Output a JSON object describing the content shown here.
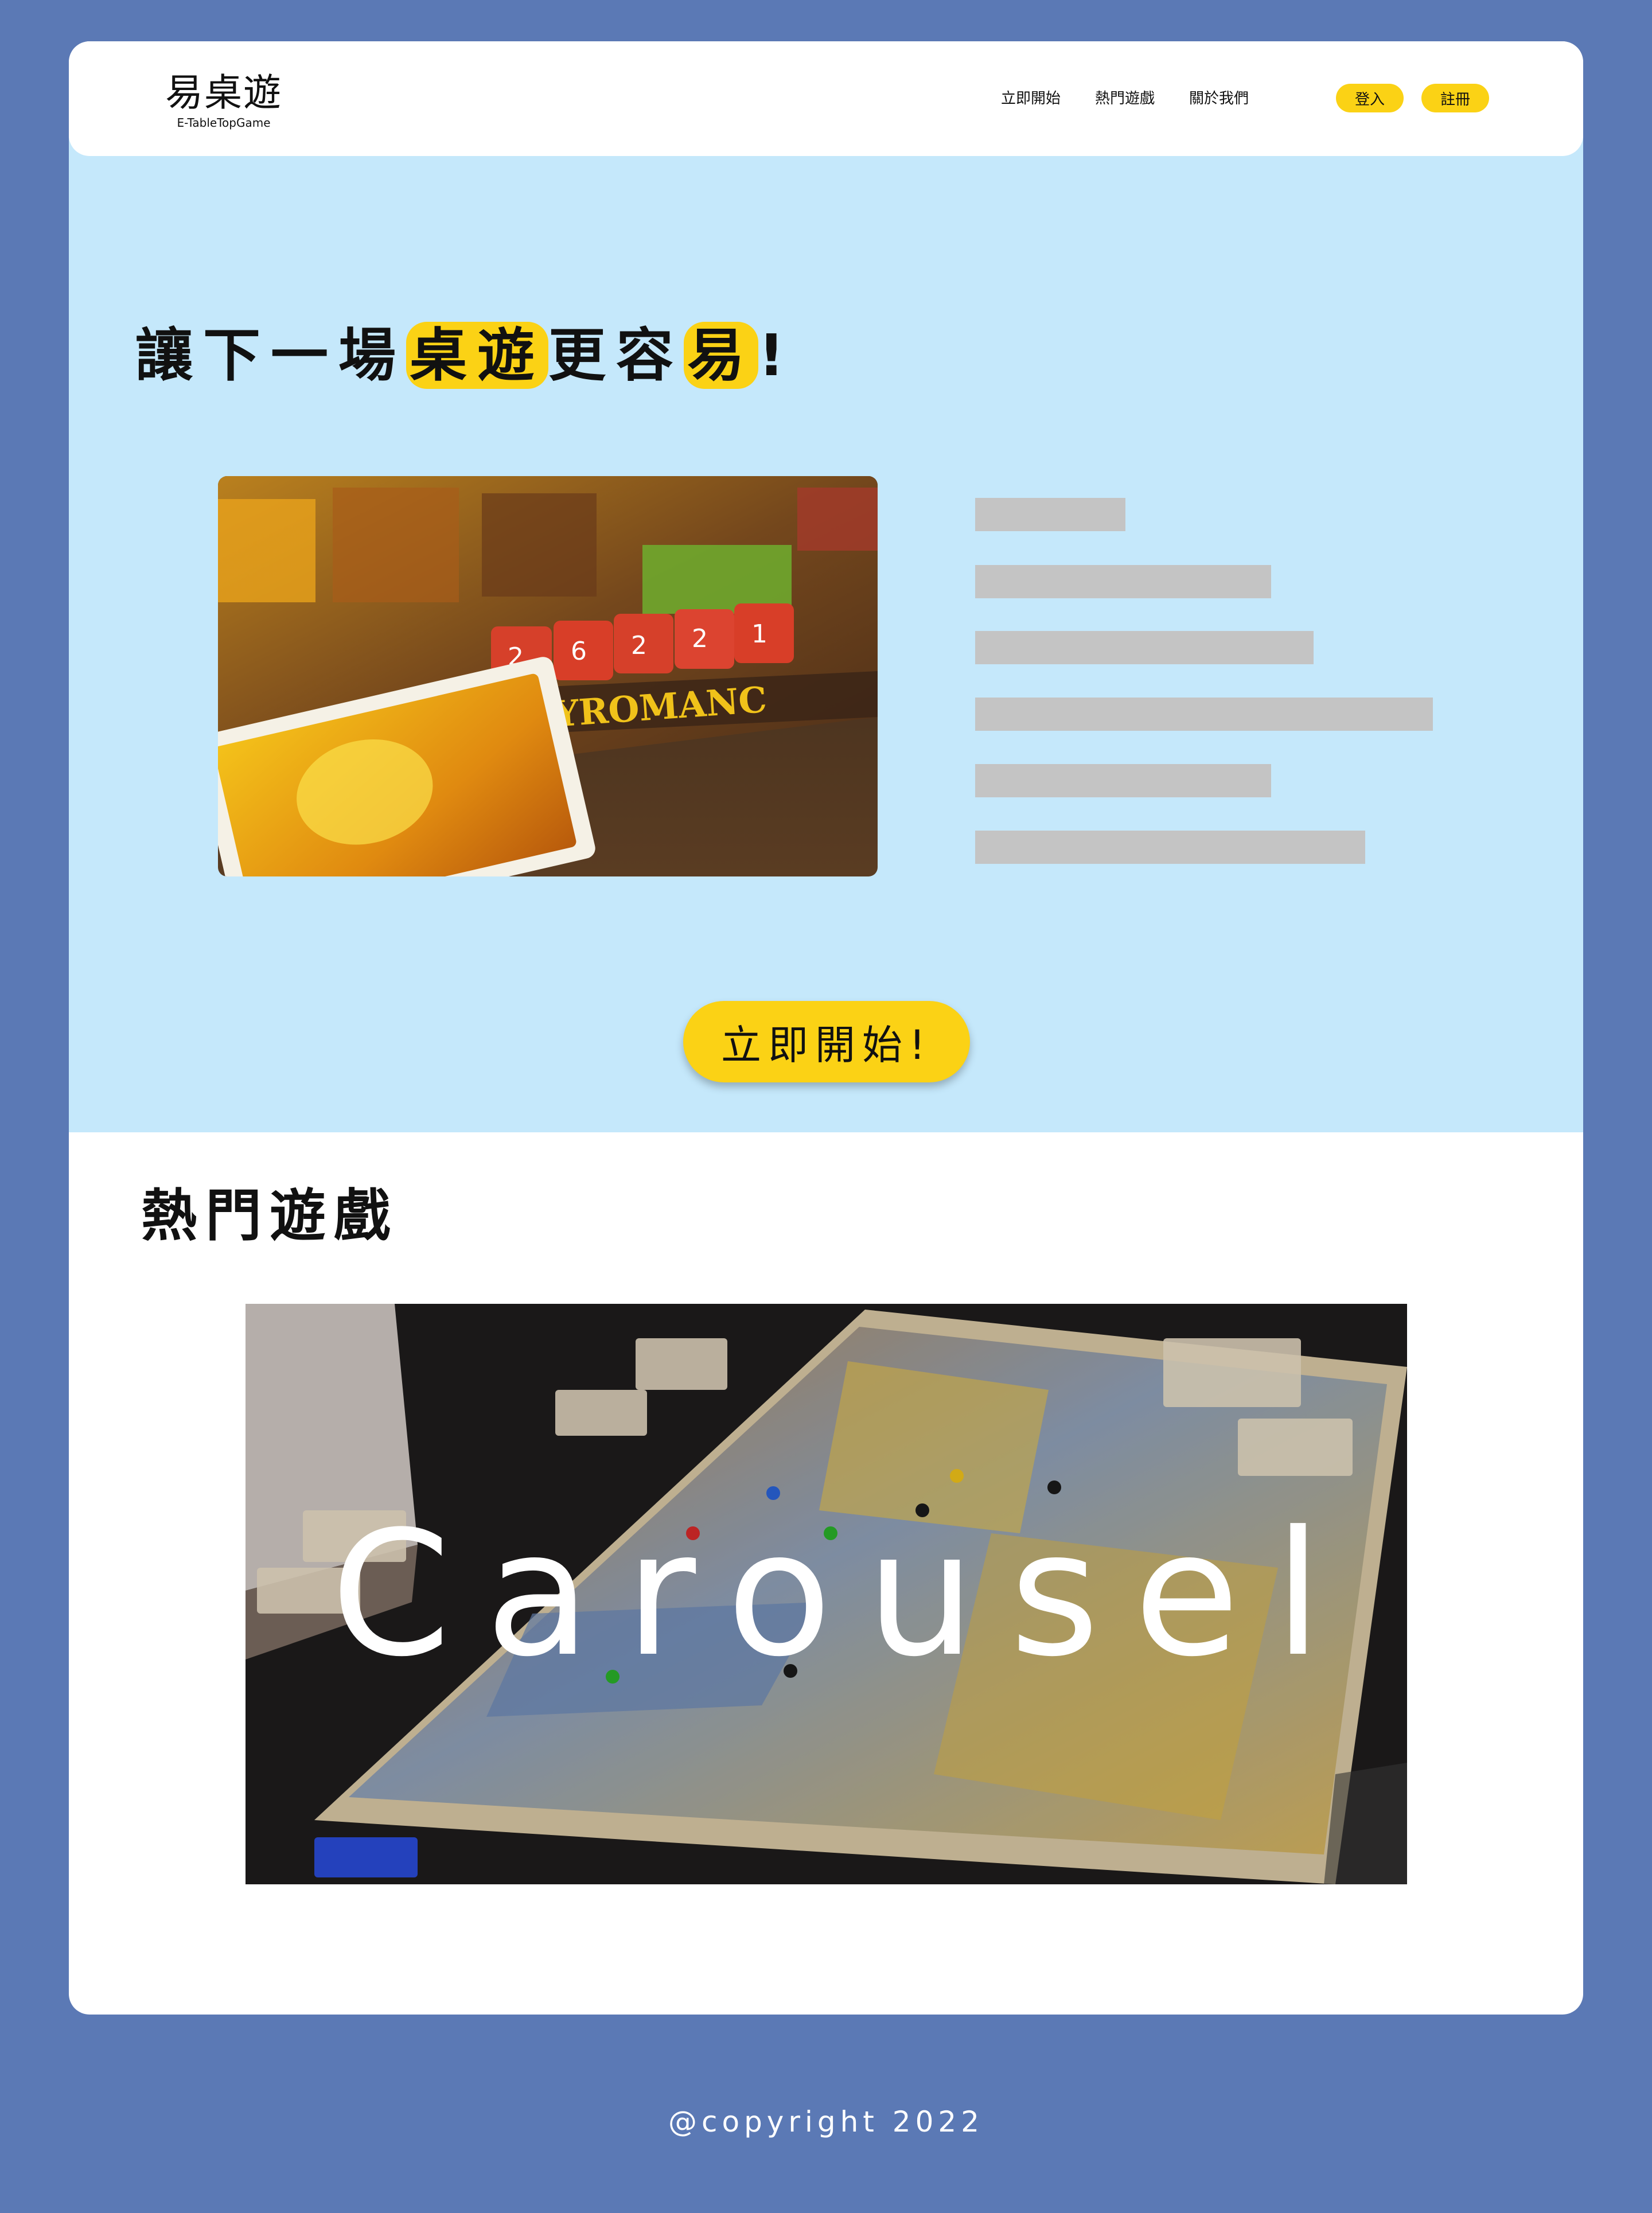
{
  "logo": {
    "main": "易桌遊",
    "sub": "E-TableTopGame"
  },
  "nav": {
    "items": [
      "立即開始",
      "熱門遊戲",
      "關於我們"
    ]
  },
  "auth": {
    "login": "登入",
    "signup": "註冊"
  },
  "hero": {
    "title_parts": [
      "讓下一場",
      "桌遊",
      "更容",
      "易",
      "!"
    ],
    "image_name": "pyromancer-board-game-photo",
    "cta": "立即開始!"
  },
  "popular": {
    "title": "熱門遊戲",
    "carousel_label": "Carousel"
  },
  "footer": {
    "copyright": "@copyright 2022"
  },
  "colors": {
    "background": "#5b79b5",
    "hero_bg": "#c5e8fb",
    "accent": "#fbd215",
    "placeholder": "#c4c4c4"
  }
}
